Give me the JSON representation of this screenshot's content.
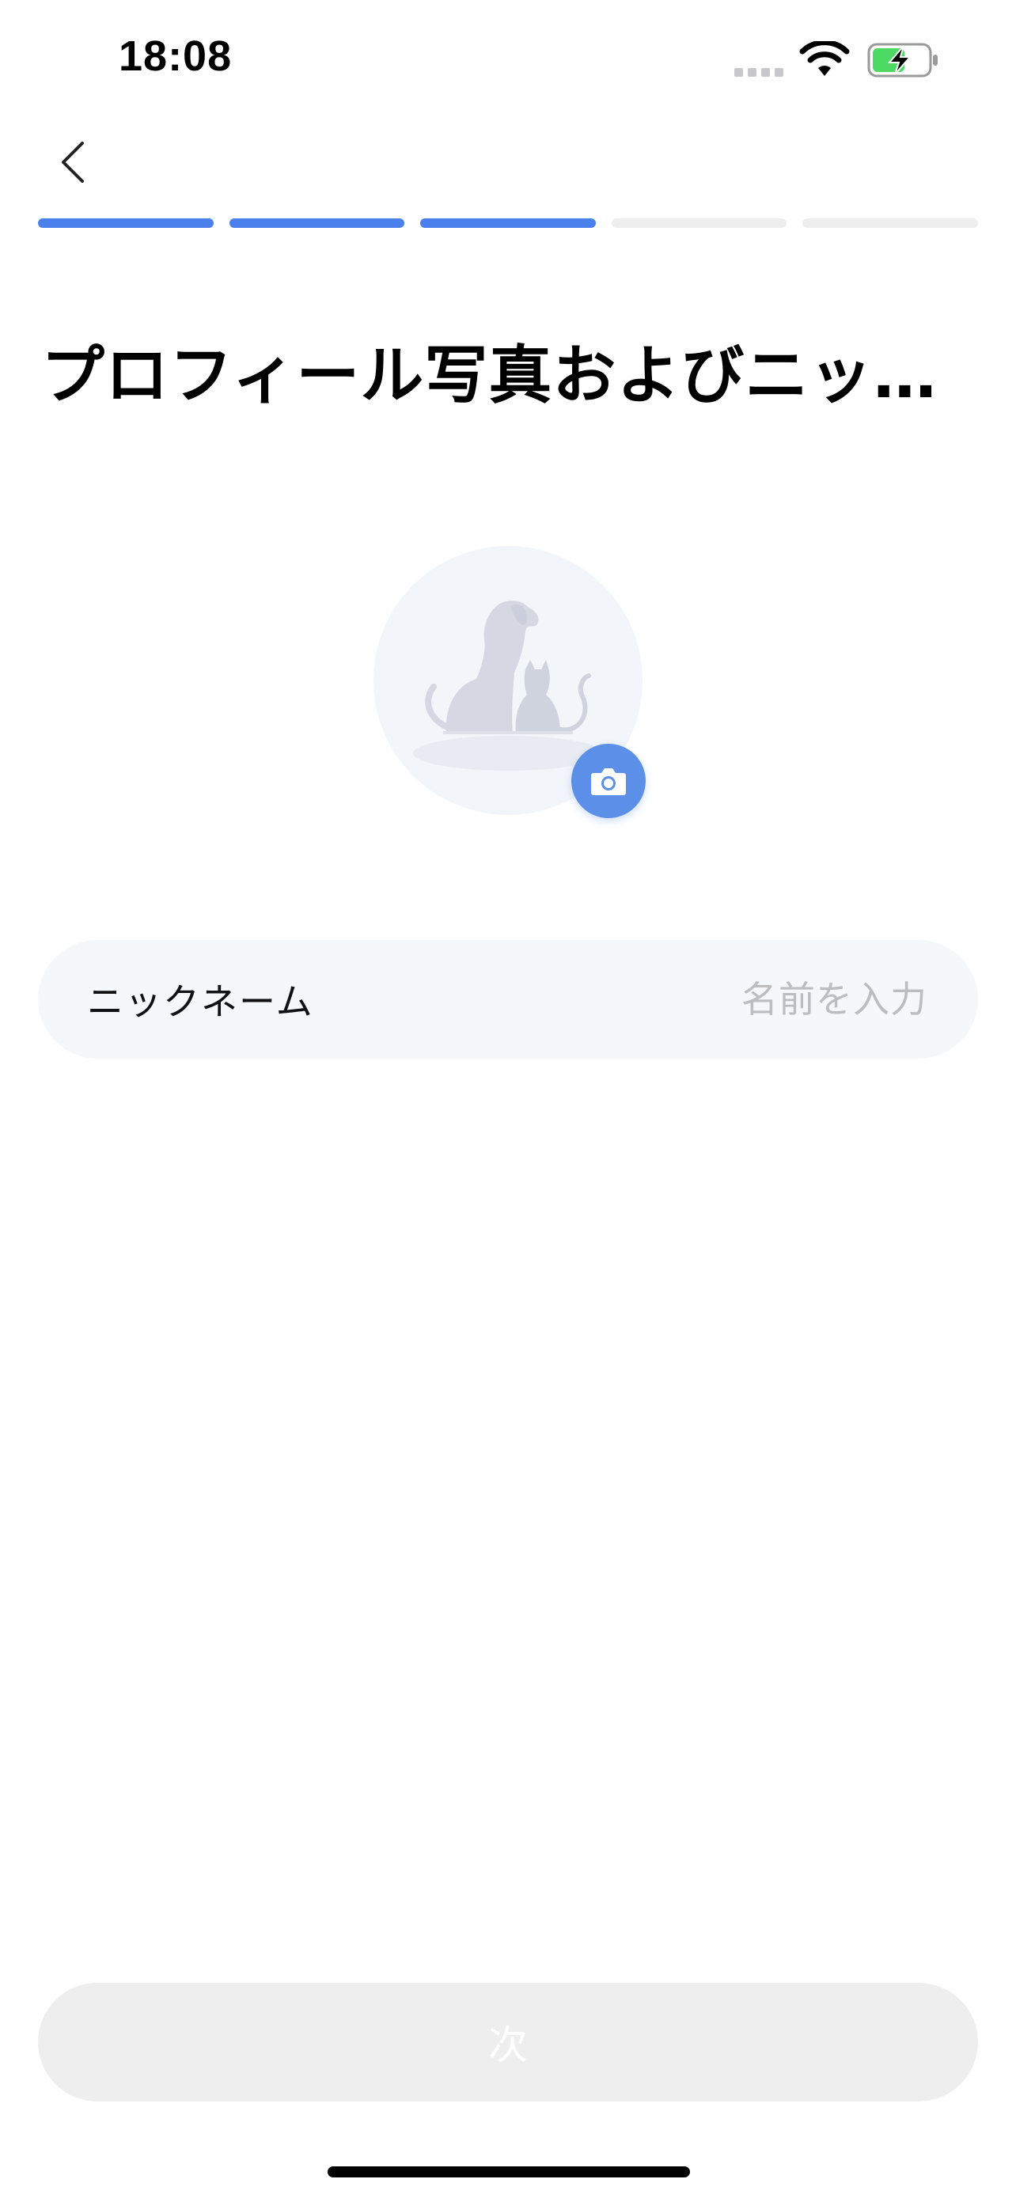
{
  "status_bar": {
    "time": "18:08"
  },
  "header": {
    "back_icon": "chevron-left-icon"
  },
  "progress": {
    "steps": [
      {
        "done": true
      },
      {
        "done": true
      },
      {
        "done": true
      },
      {
        "done": false
      },
      {
        "done": false
      }
    ],
    "active_color": "#4a80ec",
    "inactive_color": "#eeeeee"
  },
  "title": "プロフィール写真およびニックネーム",
  "avatar": {
    "placeholder_icon": "dog-cat-silhouette-icon",
    "badge_icon": "camera-icon",
    "badge_color": "#5b8fe8"
  },
  "nickname": {
    "label": "ニックネーム",
    "value": "",
    "placeholder": "名前を入力"
  },
  "next_button": {
    "label": "次"
  }
}
